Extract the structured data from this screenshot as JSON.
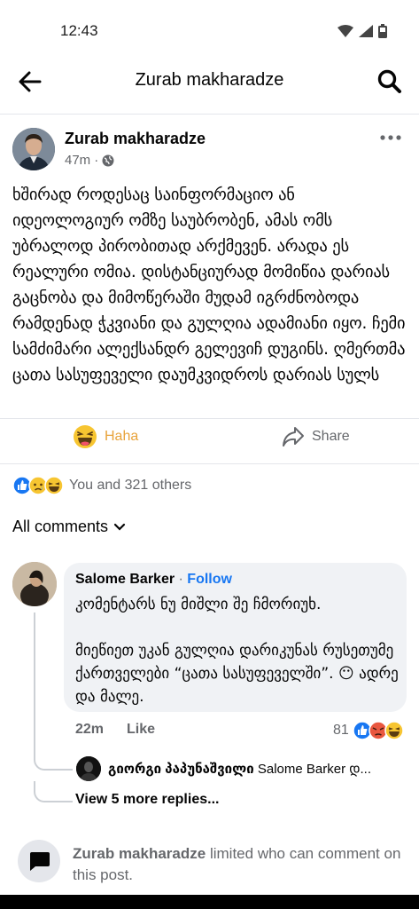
{
  "status_bar": {
    "time": "12:43",
    "icons": [
      "wifi-icon",
      "signal-icon",
      "battery-icon"
    ]
  },
  "topbar": {
    "title": "Zurab makharadze"
  },
  "post": {
    "author": "Zurab makharadze",
    "time": "47m",
    "separator": "·",
    "text": "ხშირად როდესაც საინფორმაციო ან იდეოლოგიურ ომზე საუბრობენ, ამას ომს უბრალოდ პირობითად არქმევენ. არადა ეს რეალური ომია. დისტანციურად მომიწია დარიას გაცნობა და მიმოწერაში მუდამ იგრძნობოდა რამდენად ჭკვიანი და გულღია ადამიანი იყო. ჩემი სამძიმარი ალექსანდრ გელევიჩ დუგინს. ღმერთმა ცათა სასუფეველი დაუმკვიდროს დარიას სულს",
    "actions": {
      "haha": "Haha",
      "share": "Share"
    },
    "reactions_text": "You and 321 others"
  },
  "comments": {
    "filter": "All comments",
    "items": [
      {
        "author": "Salome Barker",
        "dot": "·",
        "follow": "Follow",
        "line1": "კომენტარს ნუ მიშლი შე ჩმორიუხ.",
        "line2": "მიეწიეთ უკან გულღია დარიკუნას რუსეთუმე ქართველები “ცათა სასუფეველში”. 😶 ადრე და მალე.",
        "time": "22m",
        "like": "Like",
        "reaction_count": "81"
      }
    ],
    "reply_preview": {
      "author": "გიორგი პაპუნაშვილი",
      "text": "Salome Barker დ..."
    },
    "view_more": "View 5 more replies..."
  },
  "footer": {
    "name": "Zurab makharadze",
    "text": "limited who can comment on this post."
  },
  "colors": {
    "accent": "#1877f2",
    "haha": "#e8a33b",
    "muted": "#65676b",
    "bubble": "#f0f2f5"
  }
}
